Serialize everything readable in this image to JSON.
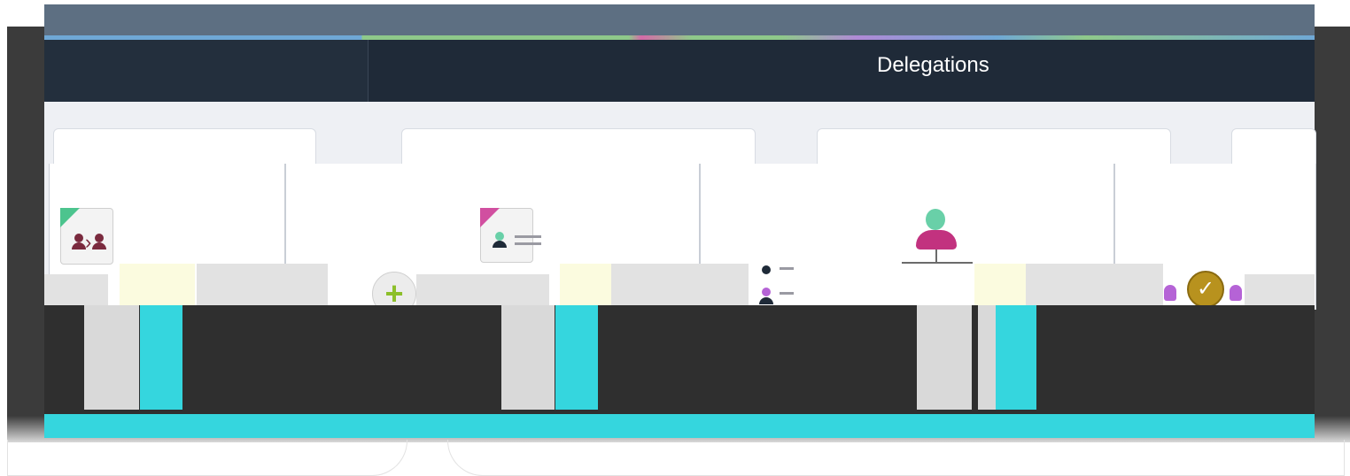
{
  "header": {
    "title": "Delegations"
  },
  "icons": {
    "tile_1": "delegate-users-icon",
    "tile_2": "user-list-document-icon",
    "tile_3": "org-hierarchy-icon",
    "add": "plus-icon",
    "approve": "check-icon"
  },
  "glyphs": {
    "separator": "›",
    "plus": "+",
    "check": "✓"
  },
  "colors": {
    "nav": "#1f2a38",
    "topbar": "#5d6f82",
    "cyan_accent": "#35d6de",
    "green_plus": "#8cbf2a",
    "gold_check": "#b8921e",
    "magenta": "#c2327f",
    "mint": "#69d0a8",
    "purple": "#b563d6"
  }
}
